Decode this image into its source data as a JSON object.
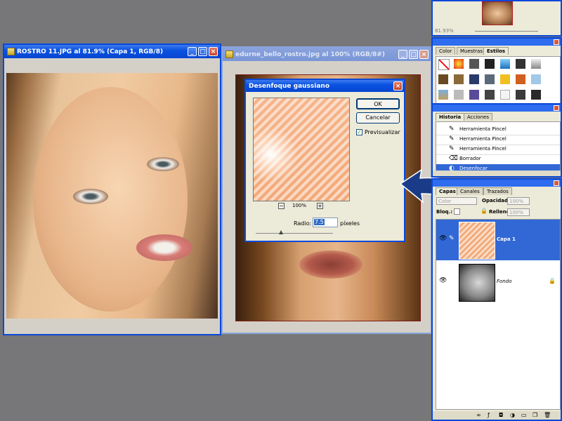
{
  "window1": {
    "title": "ROSTRO 11.JPG al 81.9% (Capa 1, RGB/8)"
  },
  "window2": {
    "title": "edurne_bello_rostro.jpg al 100% (RGB/8#)"
  },
  "dialog": {
    "title": "Desenfoque gaussiano",
    "ok": "OK",
    "cancel": "Cancelar",
    "preview": "Previsualizar",
    "zoom": "100%",
    "radius_label": "Radio:",
    "radius_value": "7.5",
    "radius_unit": "píxeles"
  },
  "navigator": {
    "zoom": "81.93%"
  },
  "styles_panel": {
    "tabs": [
      "Color",
      "Muestras",
      "Estilos"
    ]
  },
  "history": {
    "tabs": [
      "Historia",
      "Acciones"
    ],
    "items": [
      "Herramienta Pincel",
      "Herramienta Pincel",
      "Herramienta Pincel",
      "Borrador",
      "Desenfocar"
    ]
  },
  "layers": {
    "tabs": [
      "Capas",
      "Canales",
      "Trazados"
    ],
    "blend": "Color",
    "opacity_label": "Opacidad:",
    "opacity": "100%",
    "lock_label": "Bloq.:",
    "fill_label": "Relleno:",
    "fill": "100%",
    "items": [
      {
        "name": "Capa 1"
      },
      {
        "name": "Fondo"
      }
    ]
  },
  "colors": {
    "accent": "#0a48d8",
    "selection": "#3168d5",
    "dialog_bg": "#ecead8"
  }
}
